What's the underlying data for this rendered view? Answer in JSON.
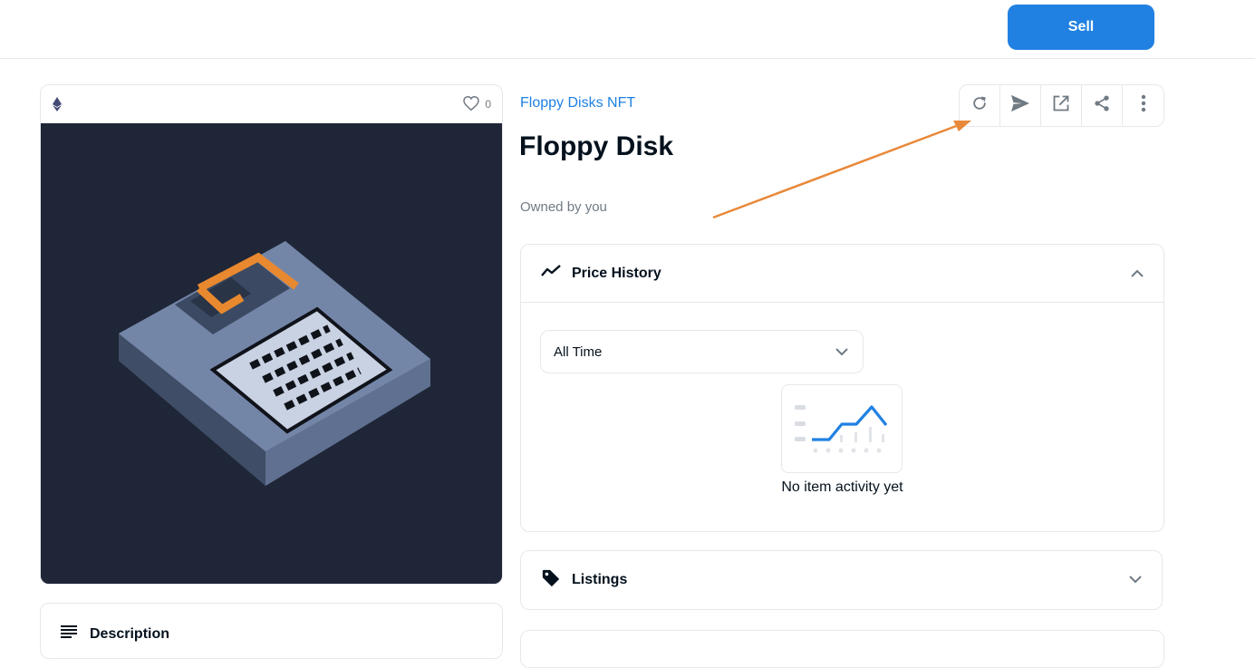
{
  "header": {
    "sell_label": "Sell"
  },
  "item": {
    "favorites_count": "0",
    "collection": "Floppy Disks NFT",
    "title": "Floppy Disk",
    "owner_text": "Owned by you"
  },
  "description": {
    "title": "Description"
  },
  "actions": [
    "refresh-icon",
    "send-icon",
    "external-link-icon",
    "share-icon",
    "more-vertical-icon"
  ],
  "price_history": {
    "title": "Price History",
    "range_selected": "All Time",
    "empty_text": "No item activity yet"
  },
  "listings": {
    "title": "Listings"
  },
  "colors": {
    "accent": "#2081e2",
    "annotation_arrow": "#e8893a",
    "art_background": "#1f2637"
  }
}
